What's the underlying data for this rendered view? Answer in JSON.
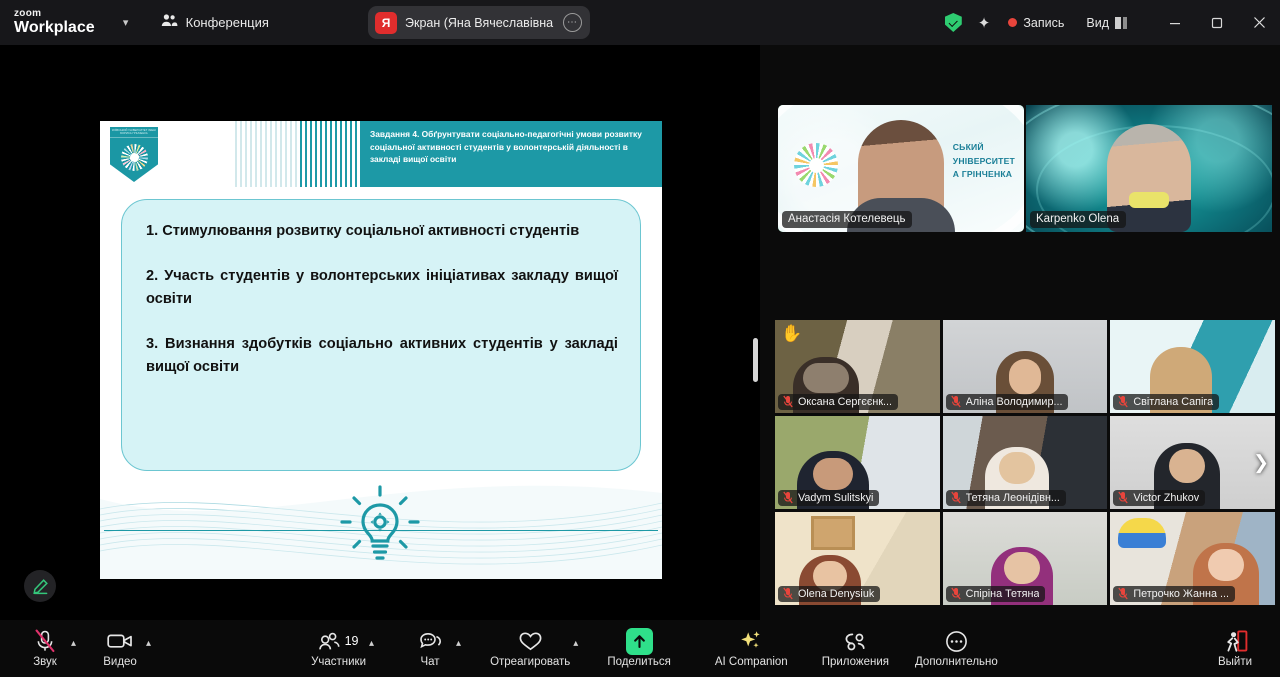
{
  "titlebar": {
    "logo_line1": "zoom",
    "logo_line2": "Workplace",
    "dropdown_icon": "chevron-down-icon",
    "meeting_label": "Конференция",
    "meeting_icon": "people-icon",
    "share_tab": {
      "avatar_initial": "Я",
      "title": "Экран (Яна Вячеславівна Марть",
      "more_icon": "more-options-icon"
    },
    "security_icon": "shield-check-icon",
    "ai_icon": "ai-sparkle-icon",
    "recording_label": "Запись",
    "recording_color": "#e8453c",
    "view_label": "Вид",
    "view_icon": "layout-icon",
    "minimize_icon": "minimize-icon",
    "maximize_icon": "maximize-icon",
    "close_icon": "close-icon"
  },
  "slide": {
    "header_text": "Завдання 4. Обґрунтувати соціально-педагогічні умови розвитку соціальної активності студентів у волонтерській діяльності в закладі вищої освіти",
    "logo_caption": "КИЇВСЬКИЙ УНІВЕРСИТЕТ ІМЕНІ БОРИСА ГРІНЧЕНКА",
    "items": [
      "1. Стимулювання розвитку соціальної активності студентів",
      "2. Участь студентів у волонтерських ініціативах закладу вищої освіти",
      "3. Визнання здобутків соціально активних студентів у закладі вищої освіти"
    ],
    "footer_icon": "lightbulb-gear-icon",
    "accent_color": "#1d99a6",
    "callout_bg": "#d6f3f6",
    "annotate_icon": "pencil-icon"
  },
  "speakers": [
    {
      "name": "Анастасія Котелевець",
      "muted": true,
      "active_speaker": true,
      "background_text": [
        "СЬКИЙ",
        "УНІВЕРСИТЕТ",
        "А ГРІНЧЕНКА"
      ]
    },
    {
      "name": "Karpenko Olena",
      "muted": true,
      "active_speaker": false
    }
  ],
  "participant_grid": {
    "next_page_icon": "chevron-right-icon",
    "tiles": [
      {
        "name": "Оксана Сергєєнк...",
        "muted": true,
        "hand_raised": true
      },
      {
        "name": "Аліна Володимир...",
        "muted": true,
        "hand_raised": false
      },
      {
        "name": "Світлана Сапіга",
        "muted": true,
        "hand_raised": false
      },
      {
        "name": "Vadym Sulitskyi",
        "muted": true,
        "hand_raised": false
      },
      {
        "name": "Тетяна Леонідівн...",
        "muted": true,
        "hand_raised": false
      },
      {
        "name": "Victor Zhukov",
        "muted": true,
        "hand_raised": false
      },
      {
        "name": "Olena Denysiuk",
        "muted": true,
        "hand_raised": false
      },
      {
        "name": "Спіріна Тетяна",
        "muted": true,
        "hand_raised": false
      },
      {
        "name": "Петрочко Жанна ...",
        "muted": true,
        "hand_raised": false
      }
    ]
  },
  "toolbar": {
    "audio_label": "Звук",
    "audio_icon": "microphone-muted-icon",
    "audio_muted": true,
    "video_label": "Видео",
    "video_icon": "camera-icon",
    "participants_label": "Участники",
    "participants_icon": "people-icon",
    "participants_count": "19",
    "chat_label": "Чат",
    "chat_icon": "chat-bubble-icon",
    "react_label": "Отреагировать",
    "react_icon": "heart-icon",
    "share_label": "Поделиться",
    "share_icon": "share-screen-icon",
    "share_color": "#2fe08a",
    "ai_label": "AI Companion",
    "ai_icon": "ai-sparkle-icon",
    "apps_label": "Приложения",
    "apps_icon": "apps-icon",
    "more_label": "Дополнительно",
    "more_icon": "more-dots-icon",
    "leave_label": "Выйти",
    "leave_icon": "leave-door-icon",
    "leave_color": "#e02d2d"
  }
}
